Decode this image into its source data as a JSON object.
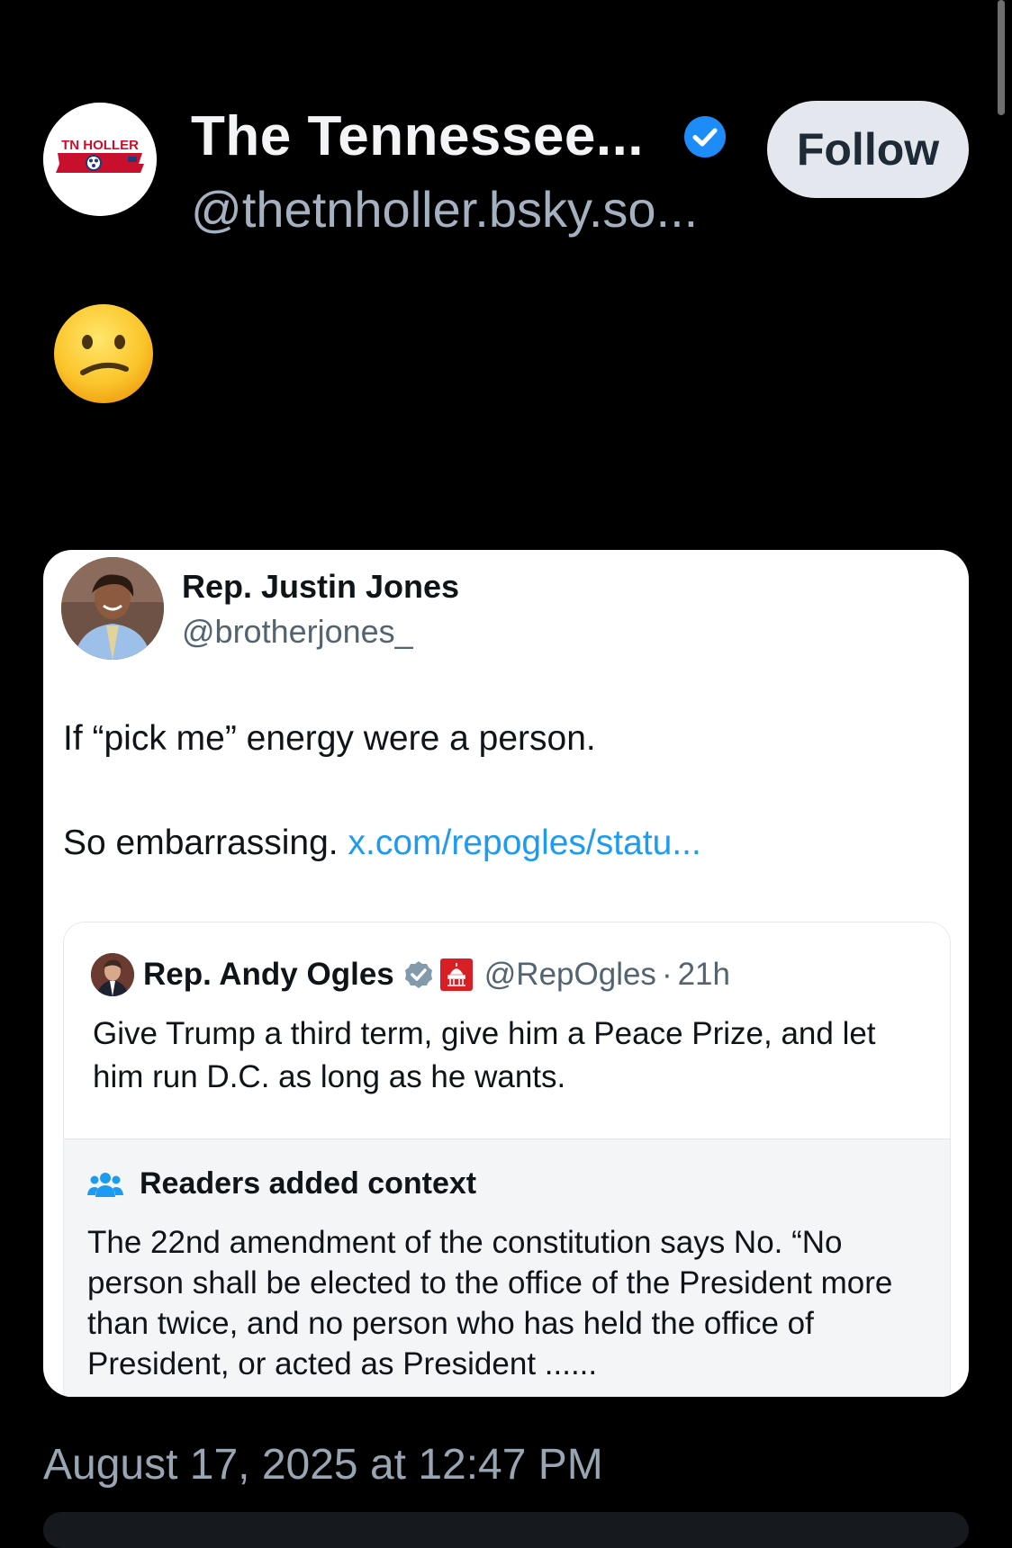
{
  "post": {
    "author": {
      "display_name": "The Tennessee...",
      "handle": "@thetnholler.bsky.so...",
      "avatar_logo_text": "TN HOLLER",
      "verified_icon": "verified-check-icon"
    },
    "follow_label": "Follow",
    "body_emoji": "confused-face-emoji",
    "timestamp": "August 17, 2025 at 12:47 PM"
  },
  "quoted_post": {
    "author_name": "Rep. Justin Jones",
    "author_handle": "@brotherjones_",
    "text_line_1": "If “pick me” energy were a person.",
    "text_line_2_prefix": "So embarrassing. ",
    "text_line_2_link": "x.com/repogles/statu...",
    "inner_quote": {
      "author_name": "Rep. Andy Ogles",
      "badges": [
        "gray-verified-icon",
        "capitol-badge-icon"
      ],
      "author_handle": "@RepOgles",
      "separator": "·",
      "time": "21h",
      "text": "Give Trump a third term, give him a Peace Prize, and let him run D.C. as long as he wants.",
      "context": {
        "icon": "people-icon",
        "title": "Readers added context",
        "text": "The 22nd amendment of the constitution says No. “No person shall be elected to the office of the President more than twice, and no person who has held the office of President, or acted as President ......"
      }
    }
  },
  "colors": {
    "background": "#000000",
    "accent_link": "#1d9bf0",
    "verified_blue": "#1d8cf8",
    "follow_button_bg": "#e4e8ee"
  }
}
